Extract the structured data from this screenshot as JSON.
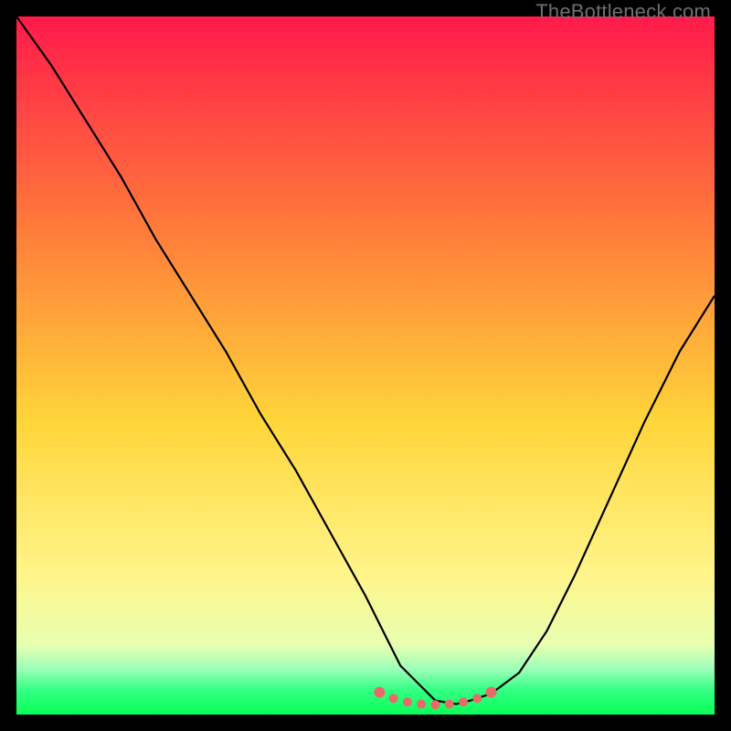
{
  "watermark": "TheBottleneck.com",
  "colors": {
    "gradient_top": "#ff1a4b",
    "gradient_mid1": "#ff7a3a",
    "gradient_mid2": "#ffd53a",
    "gradient_mid3": "#fff58a",
    "gradient_bottom": "#11ff5f",
    "curve": "#000000",
    "marker": "#e86a6a",
    "watermark": "#6f6f6f"
  },
  "chart_data": {
    "type": "line",
    "title": "",
    "xlabel": "",
    "ylabel": "",
    "xlim": [
      0,
      100
    ],
    "ylim": [
      0,
      100
    ],
    "series": [
      {
        "name": "bottleneck-curve",
        "x": [
          0,
          5,
          10,
          15,
          20,
          25,
          30,
          35,
          40,
          45,
          50,
          53,
          55,
          58,
          60,
          63,
          65,
          68,
          72,
          76,
          80,
          85,
          90,
          95,
          100
        ],
        "y": [
          100,
          93,
          85,
          77,
          68,
          60,
          52,
          43,
          35,
          26,
          17,
          11,
          7,
          4,
          2,
          1.5,
          2,
          3,
          6,
          12,
          20,
          31,
          42,
          52,
          60
        ]
      }
    ],
    "markers": {
      "name": "highlight-band",
      "x": [
        52,
        54,
        56,
        58,
        60,
        62,
        64,
        66,
        68
      ],
      "y": [
        3.2,
        2.3,
        1.8,
        1.5,
        1.4,
        1.5,
        1.8,
        2.3,
        3.2
      ]
    },
    "background_gradient_stops": [
      {
        "offset": 0.0,
        "color": "#ff1a4b"
      },
      {
        "offset": 0.3,
        "color": "#ff7a3a"
      },
      {
        "offset": 0.58,
        "color": "#ffd53a"
      },
      {
        "offset": 0.8,
        "color": "#fff58a"
      },
      {
        "offset": 0.9,
        "color": "#e8ffb0"
      },
      {
        "offset": 0.935,
        "color": "#9bffb8"
      },
      {
        "offset": 0.965,
        "color": "#33ff82"
      },
      {
        "offset": 1.0,
        "color": "#0aff5a"
      }
    ]
  }
}
